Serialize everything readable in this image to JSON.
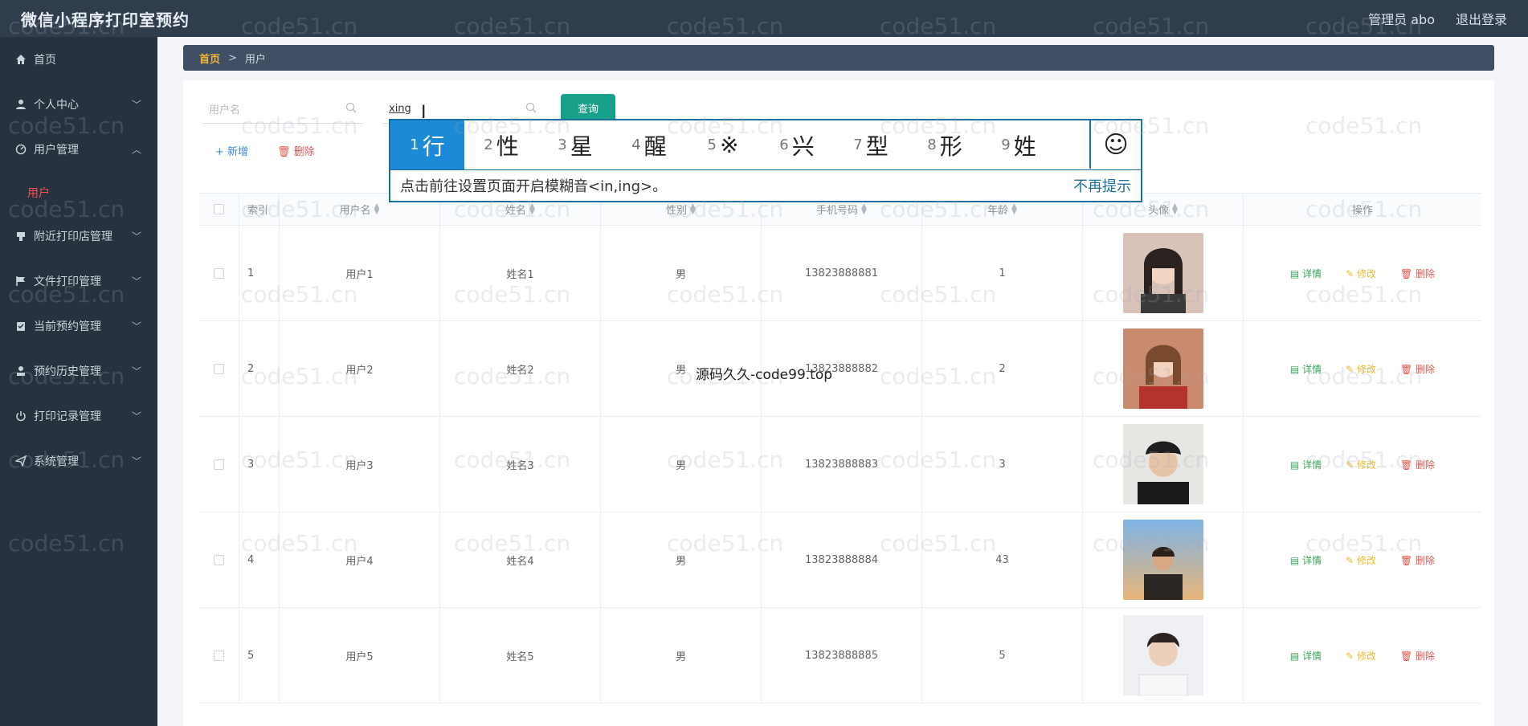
{
  "app": {
    "title": "微信小程序打印室预约"
  },
  "header": {
    "user": "管理员 abo",
    "logout": "退出登录"
  },
  "sidebar": {
    "items": [
      {
        "label": "首页",
        "icon": "home-icon",
        "arrow": false
      },
      {
        "label": "个人中心",
        "icon": "user-icon",
        "arrow": true
      },
      {
        "label": "用户管理",
        "icon": "gauge-icon",
        "arrow": true,
        "expanded": true,
        "sub": "用户"
      },
      {
        "label": "附近打印店管理",
        "icon": "printer-icon",
        "arrow": true
      },
      {
        "label": "文件打印管理",
        "icon": "flag-icon",
        "arrow": true
      },
      {
        "label": "当前预约管理",
        "icon": "clipboard-icon",
        "arrow": true
      },
      {
        "label": "预约历史管理",
        "icon": "person-icon",
        "arrow": true
      },
      {
        "label": "打印记录管理",
        "icon": "power-icon",
        "arrow": true
      },
      {
        "label": "系统管理",
        "icon": "send-icon",
        "arrow": true
      }
    ]
  },
  "breadcrumb": {
    "home": "首页",
    "separator": ">",
    "current": "用户"
  },
  "search": {
    "username_placeholder": "用户名",
    "name_value": "xing",
    "query_label": "查询"
  },
  "actions": {
    "add": "+ 新增",
    "delete": "删除"
  },
  "table": {
    "headers": {
      "index": "索引",
      "username": "用户名",
      "name": "姓名",
      "sex": "性别",
      "phone": "手机号码",
      "age": "年龄",
      "avatar": "头像",
      "ops": "操作"
    },
    "rows": [
      {
        "index": "1",
        "username": "用户1",
        "name": "姓名1",
        "sex": "男",
        "phone": "13823888881",
        "age": "1"
      },
      {
        "index": "2",
        "username": "用户2",
        "name": "姓名2",
        "sex": "男",
        "phone": "13823888882",
        "age": "2"
      },
      {
        "index": "3",
        "username": "用户3",
        "name": "姓名3",
        "sex": "男",
        "phone": "13823888883",
        "age": "3"
      },
      {
        "index": "4",
        "username": "用户4",
        "name": "姓名4",
        "sex": "男",
        "phone": "13823888884",
        "age": "43"
      },
      {
        "index": "5",
        "username": "用户5",
        "name": "姓名5",
        "sex": "男",
        "phone": "13823888885",
        "age": "5"
      }
    ],
    "ops": {
      "detail": "详情",
      "edit": "修改",
      "delete": "删除"
    }
  },
  "ime": {
    "candidates": [
      {
        "num": "1",
        "char": "行"
      },
      {
        "num": "2",
        "char": "性"
      },
      {
        "num": "3",
        "char": "星"
      },
      {
        "num": "4",
        "char": "醒"
      },
      {
        "num": "5",
        "char": "※"
      },
      {
        "num": "6",
        "char": "兴"
      },
      {
        "num": "7",
        "char": "型"
      },
      {
        "num": "8",
        "char": "形"
      },
      {
        "num": "9",
        "char": "姓"
      }
    ],
    "hint": "点击前往设置页面开启模糊音<in,ing>。",
    "no_more": "不再提示"
  },
  "watermark": {
    "text": "code51.cn",
    "mark": "源码久久-code99.top"
  },
  "colors": {
    "header_bg": "#2f3d4c",
    "sidebar_bg": "#27323e",
    "accent": "#19a08a",
    "ime_border": "#1c6f9f",
    "danger": "#e0574f"
  }
}
